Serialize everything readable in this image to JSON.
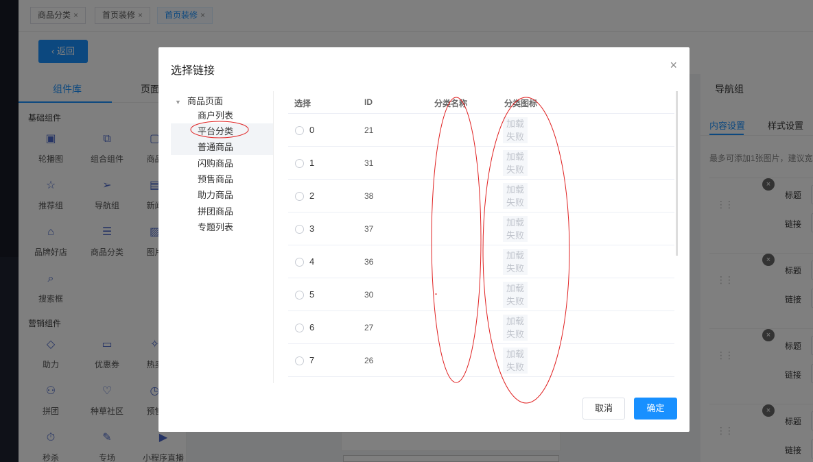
{
  "tabs": [
    {
      "label": "商品分类",
      "close": "×"
    },
    {
      "label": "首页装修",
      "close": "×"
    },
    {
      "label": "首页装修",
      "close": "×"
    }
  ],
  "back_label": "返回",
  "back_icon": "chevron-left-icon",
  "library": {
    "tabs": [
      "组件库",
      "页面"
    ],
    "groups": [
      {
        "title": "基础组件"
      },
      {
        "title": "营销组件"
      }
    ],
    "components": [
      {
        "label": "轮播图",
        "icon": "carousel-icon"
      },
      {
        "label": "组合组件",
        "icon": "combo-icon"
      },
      {
        "label": "商品",
        "icon": "goods-icon"
      },
      {
        "label": "推荐组",
        "icon": "star-icon"
      },
      {
        "label": "导航组",
        "icon": "nav-icon"
      },
      {
        "label": "新闻",
        "icon": "news-icon"
      },
      {
        "label": "品牌好店",
        "icon": "store-icon"
      },
      {
        "label": "商品分类",
        "icon": "category-icon"
      },
      {
        "label": "图片",
        "icon": "image-icon"
      },
      {
        "label": "搜索框",
        "icon": "search-icon"
      },
      {
        "label": "助力",
        "icon": "tag-icon"
      },
      {
        "label": "优惠券",
        "icon": "coupon-icon"
      },
      {
        "label": "热卖",
        "icon": "hot-icon"
      },
      {
        "label": "拼团",
        "icon": "group-icon"
      },
      {
        "label": "种草社区",
        "icon": "community-icon"
      },
      {
        "label": "预售",
        "icon": "presale-icon"
      },
      {
        "label": "秒杀",
        "icon": "clock-icon"
      },
      {
        "label": "专场",
        "icon": "special-icon"
      },
      {
        "label": "小程序直播",
        "icon": "live-icon"
      }
    ]
  },
  "right_panel": {
    "title": "导航组",
    "tabs": [
      "内容设置",
      "样式设置"
    ],
    "hint": "最多可添加1张图片，建议宽",
    "field_title": "标题",
    "field_link": "链接",
    "delete": "×",
    "drag": "⋮⋮"
  },
  "modal": {
    "title": "选择链接",
    "close": "×",
    "tree_root": "商品页面",
    "tree_items": [
      "商户列表",
      "平台分类",
      "普通商品",
      "闪购商品",
      "预售商品",
      "助力商品",
      "拼团商品",
      "专题列表"
    ],
    "selected_index": 1,
    "columns": {
      "select": "选择",
      "id": "ID",
      "name": "分类名称",
      "icon": "分类图标"
    },
    "rows": [
      {
        "label": "0",
        "id": "21",
        "img": "加载失败"
      },
      {
        "label": "1",
        "id": "31",
        "img": "加载失败"
      },
      {
        "label": "2",
        "id": "38",
        "img": "加载失败"
      },
      {
        "label": "3",
        "id": "37",
        "img": "加载失败"
      },
      {
        "label": "4",
        "id": "36",
        "img": "加载失败"
      },
      {
        "label": "5",
        "id": "30",
        "img": "加载失败"
      },
      {
        "label": "6",
        "id": "27",
        "img": "加载失败"
      },
      {
        "label": "7",
        "id": "26",
        "img": "加载失败"
      }
    ],
    "cancel_label": "取消",
    "ok_label": "确定"
  },
  "colors": {
    "primary": "#1890ff",
    "annotation": "#e02020",
    "overlay": "rgba(0,0,0,0.5)"
  }
}
